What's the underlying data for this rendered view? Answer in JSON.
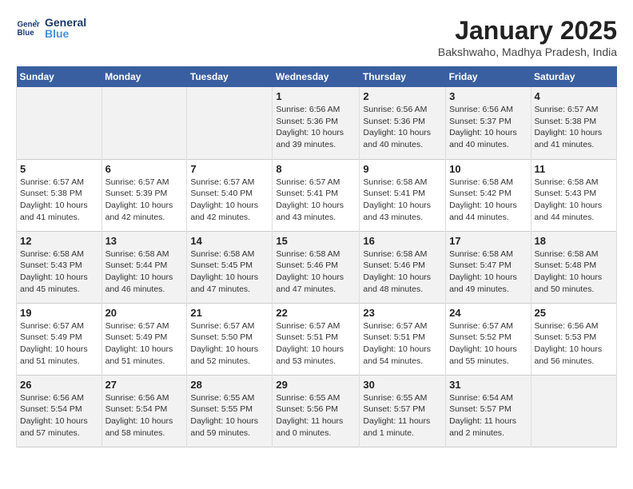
{
  "header": {
    "logo_line1": "General",
    "logo_line2": "Blue",
    "month": "January 2025",
    "location": "Bakshwaho, Madhya Pradesh, India"
  },
  "days_of_week": [
    "Sunday",
    "Monday",
    "Tuesday",
    "Wednesday",
    "Thursday",
    "Friday",
    "Saturday"
  ],
  "weeks": [
    [
      {
        "day": "",
        "info": ""
      },
      {
        "day": "",
        "info": ""
      },
      {
        "day": "",
        "info": ""
      },
      {
        "day": "1",
        "info": "Sunrise: 6:56 AM\nSunset: 5:36 PM\nDaylight: 10 hours\nand 39 minutes."
      },
      {
        "day": "2",
        "info": "Sunrise: 6:56 AM\nSunset: 5:36 PM\nDaylight: 10 hours\nand 40 minutes."
      },
      {
        "day": "3",
        "info": "Sunrise: 6:56 AM\nSunset: 5:37 PM\nDaylight: 10 hours\nand 40 minutes."
      },
      {
        "day": "4",
        "info": "Sunrise: 6:57 AM\nSunset: 5:38 PM\nDaylight: 10 hours\nand 41 minutes."
      }
    ],
    [
      {
        "day": "5",
        "info": "Sunrise: 6:57 AM\nSunset: 5:38 PM\nDaylight: 10 hours\nand 41 minutes."
      },
      {
        "day": "6",
        "info": "Sunrise: 6:57 AM\nSunset: 5:39 PM\nDaylight: 10 hours\nand 42 minutes."
      },
      {
        "day": "7",
        "info": "Sunrise: 6:57 AM\nSunset: 5:40 PM\nDaylight: 10 hours\nand 42 minutes."
      },
      {
        "day": "8",
        "info": "Sunrise: 6:57 AM\nSunset: 5:41 PM\nDaylight: 10 hours\nand 43 minutes."
      },
      {
        "day": "9",
        "info": "Sunrise: 6:58 AM\nSunset: 5:41 PM\nDaylight: 10 hours\nand 43 minutes."
      },
      {
        "day": "10",
        "info": "Sunrise: 6:58 AM\nSunset: 5:42 PM\nDaylight: 10 hours\nand 44 minutes."
      },
      {
        "day": "11",
        "info": "Sunrise: 6:58 AM\nSunset: 5:43 PM\nDaylight: 10 hours\nand 44 minutes."
      }
    ],
    [
      {
        "day": "12",
        "info": "Sunrise: 6:58 AM\nSunset: 5:43 PM\nDaylight: 10 hours\nand 45 minutes."
      },
      {
        "day": "13",
        "info": "Sunrise: 6:58 AM\nSunset: 5:44 PM\nDaylight: 10 hours\nand 46 minutes."
      },
      {
        "day": "14",
        "info": "Sunrise: 6:58 AM\nSunset: 5:45 PM\nDaylight: 10 hours\nand 47 minutes."
      },
      {
        "day": "15",
        "info": "Sunrise: 6:58 AM\nSunset: 5:46 PM\nDaylight: 10 hours\nand 47 minutes."
      },
      {
        "day": "16",
        "info": "Sunrise: 6:58 AM\nSunset: 5:46 PM\nDaylight: 10 hours\nand 48 minutes."
      },
      {
        "day": "17",
        "info": "Sunrise: 6:58 AM\nSunset: 5:47 PM\nDaylight: 10 hours\nand 49 minutes."
      },
      {
        "day": "18",
        "info": "Sunrise: 6:58 AM\nSunset: 5:48 PM\nDaylight: 10 hours\nand 50 minutes."
      }
    ],
    [
      {
        "day": "19",
        "info": "Sunrise: 6:57 AM\nSunset: 5:49 PM\nDaylight: 10 hours\nand 51 minutes."
      },
      {
        "day": "20",
        "info": "Sunrise: 6:57 AM\nSunset: 5:49 PM\nDaylight: 10 hours\nand 51 minutes."
      },
      {
        "day": "21",
        "info": "Sunrise: 6:57 AM\nSunset: 5:50 PM\nDaylight: 10 hours\nand 52 minutes."
      },
      {
        "day": "22",
        "info": "Sunrise: 6:57 AM\nSunset: 5:51 PM\nDaylight: 10 hours\nand 53 minutes."
      },
      {
        "day": "23",
        "info": "Sunrise: 6:57 AM\nSunset: 5:51 PM\nDaylight: 10 hours\nand 54 minutes."
      },
      {
        "day": "24",
        "info": "Sunrise: 6:57 AM\nSunset: 5:52 PM\nDaylight: 10 hours\nand 55 minutes."
      },
      {
        "day": "25",
        "info": "Sunrise: 6:56 AM\nSunset: 5:53 PM\nDaylight: 10 hours\nand 56 minutes."
      }
    ],
    [
      {
        "day": "26",
        "info": "Sunrise: 6:56 AM\nSunset: 5:54 PM\nDaylight: 10 hours\nand 57 minutes."
      },
      {
        "day": "27",
        "info": "Sunrise: 6:56 AM\nSunset: 5:54 PM\nDaylight: 10 hours\nand 58 minutes."
      },
      {
        "day": "28",
        "info": "Sunrise: 6:55 AM\nSunset: 5:55 PM\nDaylight: 10 hours\nand 59 minutes."
      },
      {
        "day": "29",
        "info": "Sunrise: 6:55 AM\nSunset: 5:56 PM\nDaylight: 11 hours\nand 0 minutes."
      },
      {
        "day": "30",
        "info": "Sunrise: 6:55 AM\nSunset: 5:57 PM\nDaylight: 11 hours\nand 1 minute."
      },
      {
        "day": "31",
        "info": "Sunrise: 6:54 AM\nSunset: 5:57 PM\nDaylight: 11 hours\nand 2 minutes."
      },
      {
        "day": "",
        "info": ""
      }
    ]
  ]
}
